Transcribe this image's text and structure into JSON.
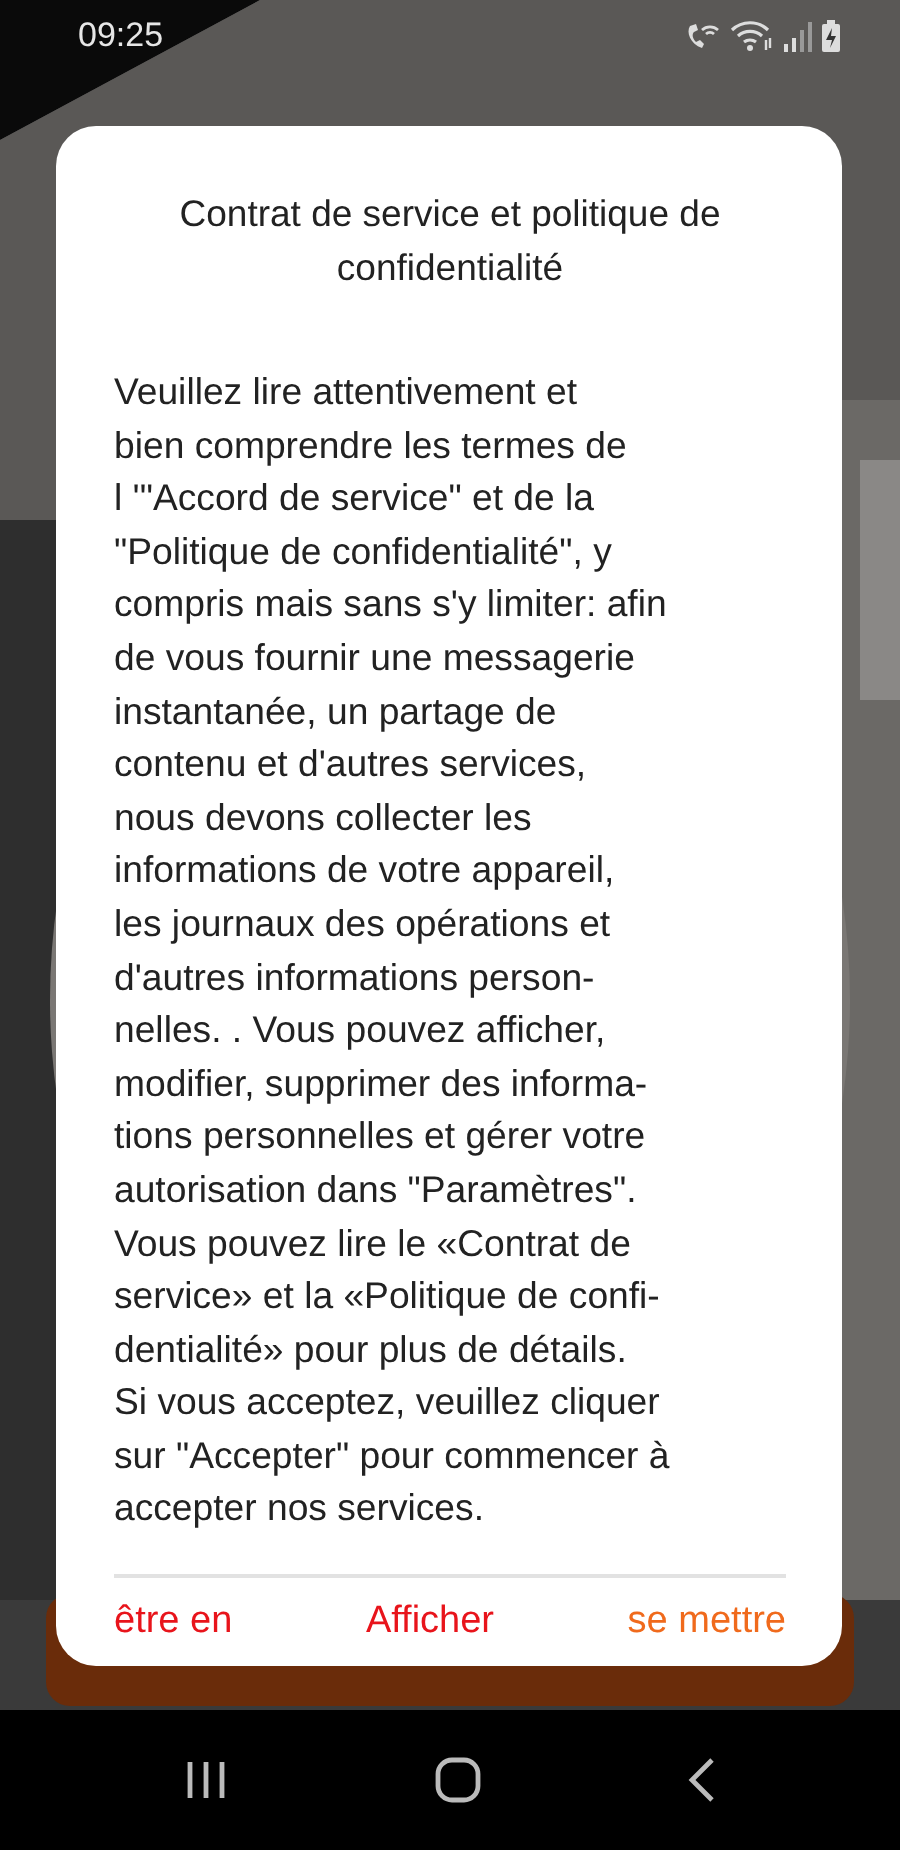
{
  "status_bar": {
    "time": "09:25"
  },
  "dialog": {
    "title": "Contrat de service et politique de confidentialité",
    "body_lines": [
      "Veuillez lire attentivement et",
      "bien comprendre les termes de",
      "l '\"Accord de service\" et de la",
      "\"Politique de confidentialité\", y",
      "compris mais sans s'y limiter: afin",
      "de vous fournir une messagerie",
      "instantanée, un partage de",
      "contenu et d'autres services,",
      "nous devons collecter les",
      "informations de votre appareil,",
      "les journaux des opérations et",
      "d'autres informations person-",
      "nelles. . Vous pouvez afficher,",
      "modifier, supprimer des informa-",
      "tions personnelles et gérer votre",
      "autorisation dans \"Paramètres\".",
      "Vous pouvez lire le «Contrat de",
      "service» et la «Politique de confi-",
      "dentialité» pour plus de détails.",
      "Si vous acceptez, veuillez cliquer",
      "sur \"Accepter\" pour commencer à",
      "accepter nos services."
    ],
    "buttons": [
      {
        "label": "être en",
        "color": "#e8141b"
      },
      {
        "label": "Afficher",
        "color": "#e8141b"
      },
      {
        "label": "se mettre",
        "color": "#f06a1c"
      }
    ]
  }
}
